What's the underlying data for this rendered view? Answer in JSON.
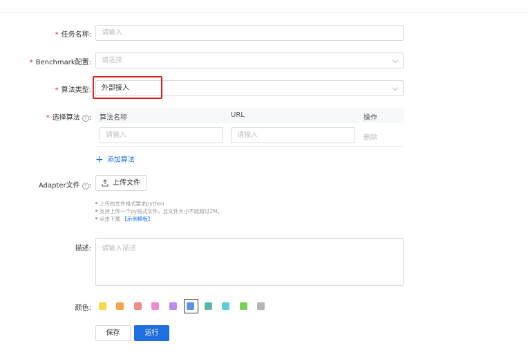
{
  "form": {
    "task_name": {
      "label": "任务名称:",
      "placeholder": "请输入"
    },
    "benchmark": {
      "label": "Benchmark配置:",
      "placeholder": "请选择"
    },
    "algo_type": {
      "label": "算法类型:",
      "value": "外部接入"
    },
    "select_algo": {
      "label": "选择算法",
      "help": "?",
      "colon": ":",
      "columns": [
        "算法名称",
        "URL",
        "操作"
      ],
      "row": {
        "name_placeholder": "请输入",
        "url_placeholder": "请输入",
        "delete": "删除"
      },
      "add_label": "添加算法",
      "add_plus": "+"
    },
    "adapter": {
      "label": "Adapter文件",
      "help": "?",
      "colon": ":",
      "upload_label": "上传文件",
      "tips": [
        "上传的文件格式要求python",
        "支持上传一个py格式文件，且文件大小不能超过2M。",
        "点击下载"
      ],
      "tip_link": "【示例模板】"
    },
    "description": {
      "label": "描述:",
      "placeholder": "请输入描述"
    },
    "color": {
      "label": "颜色:",
      "options": [
        "#f8d94a",
        "#f7a54a",
        "#f28b8b",
        "#f08ad0",
        "#b98cf0",
        "#5b93e8",
        "#5bb8a8",
        "#5ad1d6",
        "#7bd05a",
        "#b5b5b5"
      ],
      "selected_index": 5
    },
    "required_mark": "*"
  },
  "actions": {
    "save": "保存",
    "run": "运行"
  }
}
